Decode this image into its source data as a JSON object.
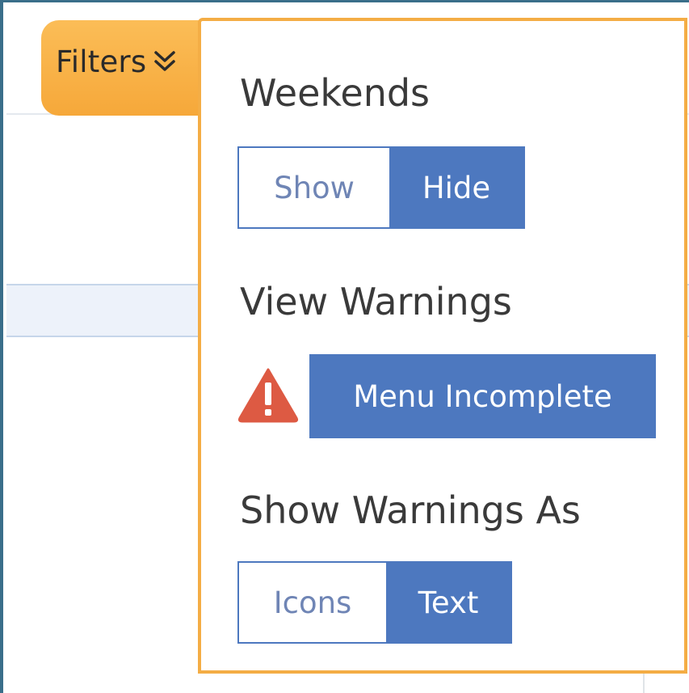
{
  "filters": {
    "label": "Filters",
    "icon": "double-chevron-down-icon",
    "accent": "#f6a83a"
  },
  "panel": {
    "border_color": "#f4ad45",
    "weekends": {
      "heading": "Weekends",
      "options": [
        "Show",
        "Hide"
      ],
      "selected": "Hide"
    },
    "view_warnings": {
      "heading": "View Warnings",
      "icon": "warning-triangle-icon",
      "icon_color": "#dd5a43",
      "warning_label": "Menu Incomplete"
    },
    "show_warnings_as": {
      "heading": "Show Warnings As",
      "options": [
        "Icons",
        "Text"
      ],
      "selected": "Text"
    }
  },
  "colors": {
    "toggle_active": "#4d78bf",
    "toggle_inactive_text": "#6f85b5"
  }
}
